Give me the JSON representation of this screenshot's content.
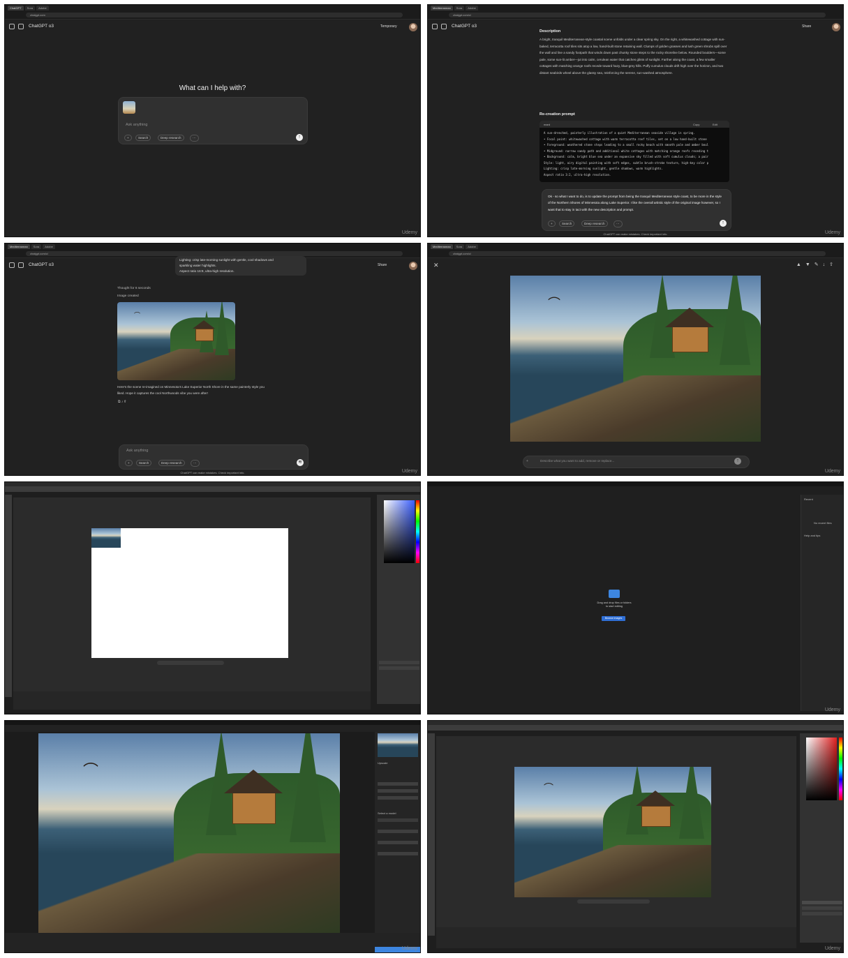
{
  "p1": {
    "model": "ChatGPT o3",
    "temporary": "Temporary",
    "heading": "What can I help with?",
    "ask_placeholder": "Ask anything",
    "search": "Search",
    "deep_research": "Deep research",
    "watermark": "Udemy"
  },
  "p2": {
    "model": "ChatGPT o3",
    "share": "Share",
    "description_title": "Description",
    "description_text": "A bright, tranquil Mediterranean-style coastal scene unfolds under a clear spring sky. On the right, a whitewashed cottage with sun-baked, terracotta roof tiles sits atop a low, hand-built stone retaining wall. Clumps of golden grasses and lush green shrubs spill over the wall and line a sandy footpath that winds down past chunky stone steps to the rocky shoreline below. Rounded boulders—some pale, some sun-lit amber—jut into calm, cerulean water that catches glints of sunlight. Farther along the coast, a few smaller cottages with matching orange roofs recede toward hazy, blue-grey hills. Puffy cumulus clouds drift high over the horizon, and two distant seabirds wheel above the glassy sea, reinforcing the serene, sun-washed atmosphere.",
    "recreation_title": "Re-creation prompt",
    "code_lang": "mard",
    "copy": "Copy",
    "edit": "Edit",
    "code_lines": [
      "A sun-drenched, painterly illustration of a quiet Mediterranean seaside village in spring.",
      "• Focal point: whitewashed cottage with warm terracotta roof tiles, set on a low hand-built stone",
      "• Foreground: weathered stone steps leading to a small rocky beach with smooth pale and amber boul",
      "• Midground: narrow sandy path and additional white cottages with matching orange roofs receding t",
      "• Background: calm, bright blue sea under an expansive sky filled with soft cumulus clouds; a pair",
      "Style: light, airy digital painting with soft edges, subtle brush-stroke texture, high-key color p",
      "Lighting: crisp late-morning sunlight, gentle shadows, warm highlights.",
      "Aspect ratio 3:2, ultra-high resolution."
    ],
    "user_text": "Ok - so what I want to do, is to update the prompt from being the tranquil Mediterranean style coast, to be more in the style of the Northern Shores of Minnesota along Lake Superior. I like the overall artistic style of the original image however, so I want that to stay in tact with the new description and prompt.",
    "search": "Search",
    "deep_research": "Deep research",
    "disclaimer": "ChatGPT can make mistakes. Check important info.",
    "watermark": "Udemy"
  },
  "p3": {
    "model": "ChatGPT o3",
    "share": "Share",
    "prev_text_1": "Lighting: crisp late-morning sunlight with gentle, cool shadows and",
    "prev_text_2": "sparkling water highlights.",
    "prev_text_3": "Aspect ratio 16:9, ultra-high resolution.",
    "thought": "Thought for 6 seconds",
    "image_created": "Image created",
    "reply_1": "Here's the scene re-imagined on Minnesota's Lake Superior North Shore in the same painterly style you",
    "reply_2": "liked. Hope it captures the cool Northwoods vibe you were after!",
    "ask_placeholder": "Ask anything",
    "search": "Search",
    "deep_research": "Deep research",
    "disclaimer": "ChatGPT can make mistakes. Check important info.",
    "watermark": "Udemy"
  },
  "p4": {
    "edit_placeholder": "Describe what you want to add, remove or replace...",
    "watermark": "Udemy"
  },
  "p6": {
    "drop_text_1": "Drag and drop files or folders",
    "drop_text_2": "to start editing",
    "browse": "Browse images",
    "recent": "Recent",
    "no_recent": "No recent files",
    "help": "Help and tips",
    "watermark": "Udemy"
  },
  "p7": {
    "select_model": "Select a model",
    "upscale": "Upscale",
    "watermark": "Udemy"
  },
  "p8": {
    "watermark": "Udemy"
  }
}
